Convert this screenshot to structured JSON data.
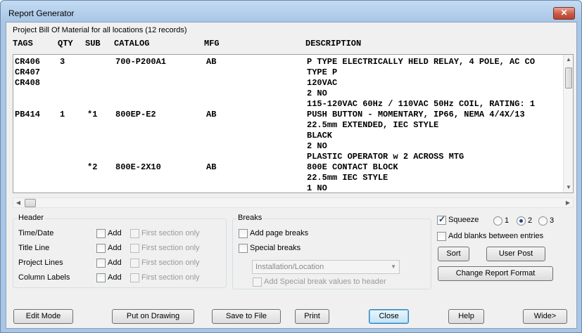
{
  "window": {
    "title": "Report Generator",
    "close_label": "✕"
  },
  "report": {
    "subtitle": "Project Bill Of Material for all locations (12 records)",
    "columns": [
      "TAGS",
      "QTY",
      "SUB",
      "CATALOG",
      "MFG",
      "DESCRIPTION"
    ],
    "rows": [
      [
        "CR406",
        "3",
        "",
        "700-P200A1",
        "AB",
        "P TYPE ELECTRICALLY HELD RELAY, 4 POLE, AC CO"
      ],
      [
        "CR407",
        "",
        "",
        "",
        "",
        "TYPE P"
      ],
      [
        "CR408",
        "",
        "",
        "",
        "",
        "120VAC"
      ],
      [
        "",
        "",
        "",
        "",
        "",
        "2 NO"
      ],
      [
        "",
        "",
        "",
        "",
        "",
        "115-120VAC 60Hz / 110VAC 50Hz COIL, RATING: 1"
      ],
      [
        "PB414",
        "1",
        "*1",
        "800EP-E2",
        "AB",
        "PUSH BUTTON - MOMENTARY, IP66, NEMA 4/4X/13"
      ],
      [
        "",
        "",
        "",
        "",
        "",
        "22.5mm EXTENDED, IEC STYLE"
      ],
      [
        "",
        "",
        "",
        "",
        "",
        "BLACK"
      ],
      [
        "",
        "",
        "",
        "",
        "",
        "2 NO"
      ],
      [
        "",
        "",
        "",
        "",
        "",
        "PLASTIC OPERATOR w 2 ACROSS MTG"
      ],
      [
        "",
        "",
        "*2",
        "800E-2X10",
        "AB",
        "800E CONTACT BLOCK"
      ],
      [
        "",
        "",
        "",
        "",
        "",
        "22.5mm IEC STYLE"
      ],
      [
        "",
        "",
        "",
        "",
        "",
        "1 NO"
      ]
    ]
  },
  "header_group": {
    "title": "Header",
    "rows": [
      {
        "label": "Time/Date",
        "add": "Add",
        "first": "First section only"
      },
      {
        "label": "Title Line",
        "add": "Add",
        "first": "First section only"
      },
      {
        "label": "Project Lines",
        "add": "Add",
        "first": "First section only"
      },
      {
        "label": "Column Labels",
        "add": "Add",
        "first": "First section only"
      }
    ]
  },
  "breaks_group": {
    "title": "Breaks",
    "page_breaks": "Add page breaks",
    "special_breaks": "Special breaks",
    "combo_value": "Installation/Location",
    "add_special": "Add Special break values to header"
  },
  "options": {
    "squeeze": "Squeeze",
    "radio_1": "1",
    "radio_2": "2",
    "radio_3": "3",
    "add_blanks": "Add blanks between entries",
    "sort": "Sort",
    "user_post": "User Post",
    "change_format": "Change Report Format"
  },
  "buttons": {
    "edit_mode": "Edit Mode",
    "put_on_drawing": "Put on Drawing",
    "save_to_file": "Save to File",
    "print": "Print",
    "close": "Close",
    "help": "Help",
    "wide": "Wide>"
  }
}
